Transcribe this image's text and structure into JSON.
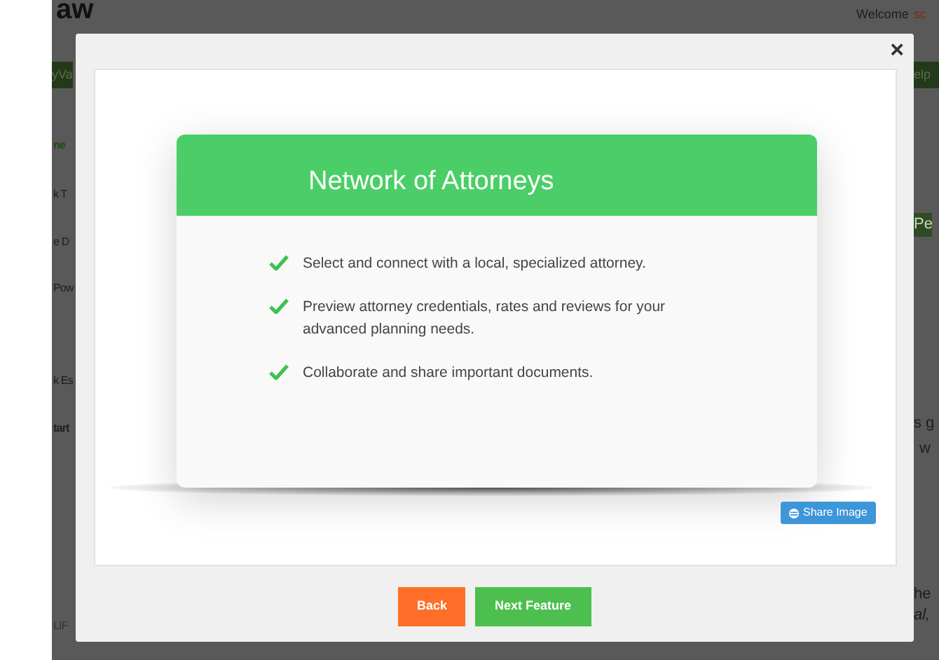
{
  "background": {
    "logo": "aw",
    "welcome": "Welcome",
    "user": "sc",
    "nav_left": "yVa",
    "nav_right": "elp",
    "left_items": [
      {
        "text": "ne",
        "kind": "heading"
      },
      {
        "text": "k T",
        "kind": "link"
      },
      {
        "text": "e D",
        "kind": "link"
      },
      {
        "text": "Pow",
        "kind": "link"
      },
      {
        "text": "k Es",
        "kind": "link"
      },
      {
        "text": "tart",
        "kind": "bold"
      },
      {
        "text": "LIF",
        "kind": "footer"
      }
    ],
    "right_items": [
      {
        "text": "Pe",
        "kind": "tab"
      },
      {
        "text": "s g",
        "kind": "text"
      },
      {
        "text": "w",
        "kind": "text"
      },
      {
        "text": "he",
        "kind": "text"
      },
      {
        "text": "al,",
        "kind": "italic"
      }
    ]
  },
  "modal": {
    "close": "×",
    "card_title": "Network of Attorneys",
    "features": [
      "Select and connect with a local, specialized attorney.",
      "Preview attorney credentials, rates and reviews for your advanced planning needs.",
      "Collaborate and share important documents."
    ],
    "share_button": "Share Image",
    "buttons": [
      {
        "label": "Back",
        "kind": "back"
      },
      {
        "label": "Next Feature",
        "kind": "next"
      }
    ]
  }
}
